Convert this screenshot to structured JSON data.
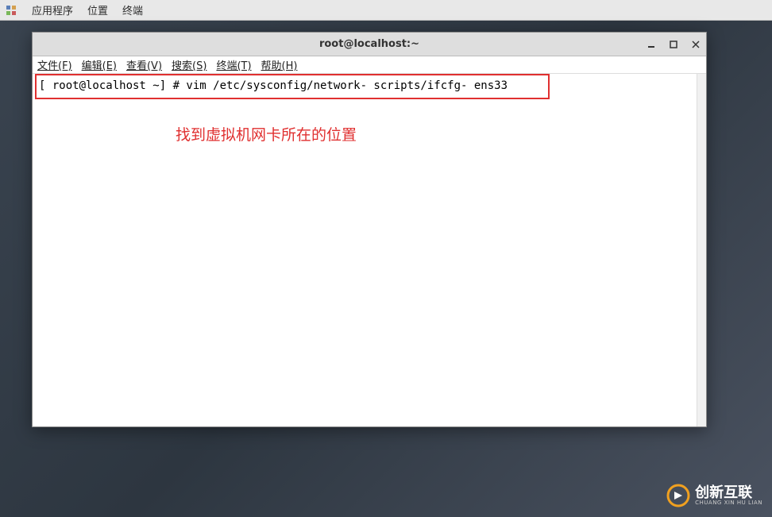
{
  "panel": {
    "apps": "应用程序",
    "places": "位置",
    "terminal": "终端"
  },
  "window": {
    "title": "root@localhost:~"
  },
  "menubar": {
    "file": "文件(F)",
    "edit": "编辑(E)",
    "view": "查看(V)",
    "search": "搜索(S)",
    "terminal": "终端(T)",
    "help": "帮助(H)"
  },
  "terminal": {
    "line1": "[ root@localhost ~] # vim /etc/sysconfig/network- scripts/ifcfg- ens33",
    "annotation": "找到虚拟机网卡所在的位置"
  },
  "watermark": {
    "main": "创新互联",
    "sub": "CHUANG XIN HU LIAN"
  }
}
